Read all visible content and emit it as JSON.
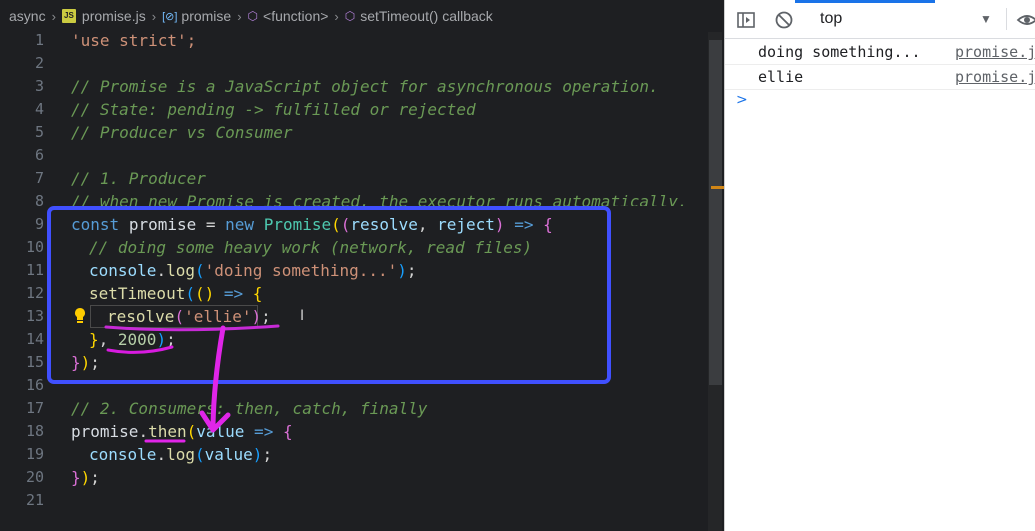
{
  "breadcrumb": {
    "folder": "async",
    "file_badge": "JS",
    "file": "promise.js",
    "symbol1": "promise",
    "symbol2": "<function>",
    "symbol3": "setTimeout() callback"
  },
  "editor": {
    "line_numbers": [
      "1",
      "2",
      "3",
      "4",
      "5",
      "6",
      "7",
      "8",
      "9",
      "10",
      "11",
      "12",
      "13",
      "14",
      "15",
      "16",
      "17",
      "18",
      "19",
      "20",
      "21"
    ],
    "code": {
      "l1_str": "'use strict';",
      "l3": "// Promise is a JavaScript object for asynchronous operation.",
      "l4": "// State: pending -> fulfilled or rejected",
      "l5": "// Producer vs Consumer",
      "l7": "// 1. Producer",
      "l8": "// when new Promise is created, the executor runs automatically.",
      "l9_kw": "const",
      "l9_var": "promise",
      "l9_eq": " = ",
      "l9_new": "new",
      "l9_cls": "Promise",
      "l9_p1": "resolve",
      "l9_comma": ", ",
      "l9_p2": "reject",
      "l9_arrow": " => ",
      "l10": "// doing some heavy work (network, read files)",
      "l11_obj": "console",
      "l11_fn": "log",
      "l11_str": "'doing something...'",
      "l12_fn": "setTimeout",
      "l12_arrow": " => ",
      "l13_fn": "resolve",
      "l13_str": "'ellie'",
      "l14_num": "2000",
      "l17": "// 2. Consumers: then, catch, finally",
      "l18_var": "promise",
      "l18_fn": "then",
      "l18_prm": "value",
      "l18_arrow": " => ",
      "l19_obj": "console",
      "l19_fn": "log",
      "l19_prm": "value"
    }
  },
  "devtools": {
    "context": "top",
    "icons": [
      "sidebar-toggle-icon",
      "clear-console-icon",
      "dropdown-chevron-icon",
      "eye-icon"
    ],
    "logs": [
      {
        "message": "doing something...",
        "source": "promise.js"
      },
      {
        "message": "ellie",
        "source": "promise.js"
      }
    ],
    "prompt": ">"
  },
  "colors": {
    "editor_bg": "#1e1f22",
    "annotation_box": "#4050ff",
    "annotation_ink": "#d81be0",
    "devtools_accent": "#1a73e8"
  }
}
